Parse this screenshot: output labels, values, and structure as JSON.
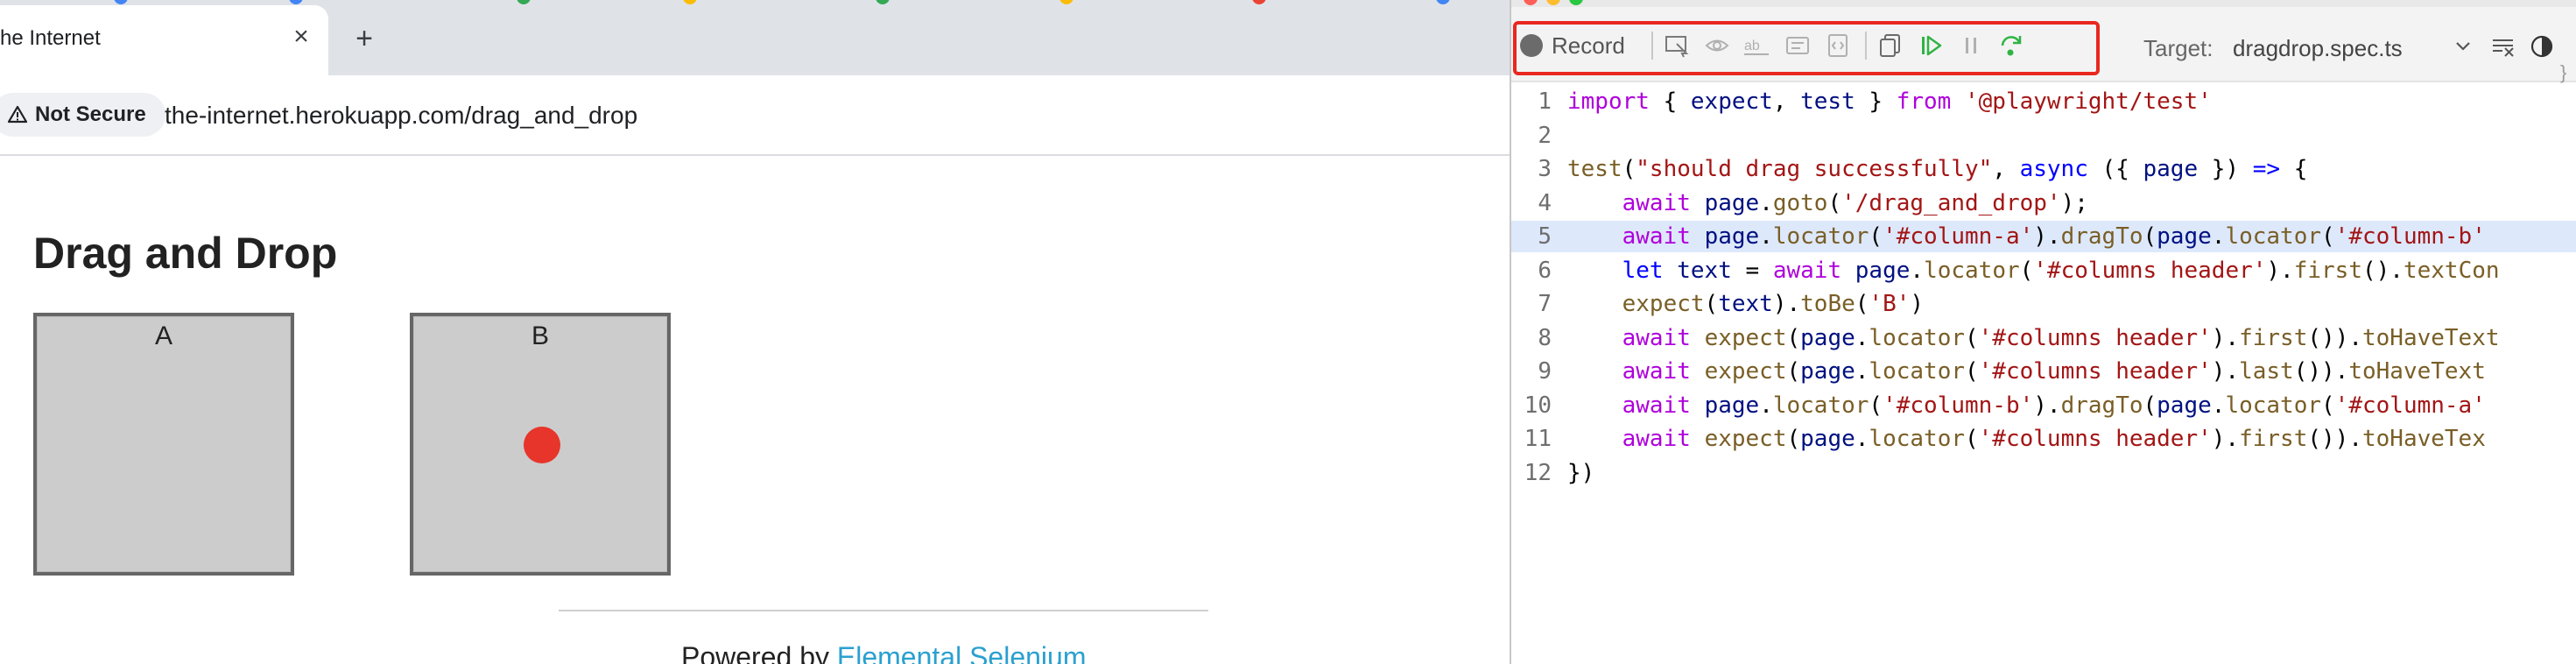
{
  "browser": {
    "tab": {
      "title": "he Internet",
      "close_glyph": "×"
    },
    "new_tab_glyph": "+",
    "security_label": "Not Secure",
    "url": "the-internet.herokuapp.com/drag_and_drop"
  },
  "page": {
    "heading": "Drag and Drop",
    "columns": [
      {
        "header": "A"
      },
      {
        "header": "B"
      }
    ],
    "footer": {
      "prefix": "Powered by ",
      "link": "Elemental Selenium"
    }
  },
  "inspector": {
    "toolbar": {
      "record_label": "Record",
      "target_label": "Target:",
      "target_value": "dragdrop.spec.ts"
    },
    "code_lines": [
      {
        "n": "1",
        "active": false,
        "tokens": [
          [
            "kw2",
            "import"
          ],
          [
            "plain",
            " { "
          ],
          [
            "var",
            "expect"
          ],
          [
            "plain",
            ", "
          ],
          [
            "var",
            "test"
          ],
          [
            "plain",
            " } "
          ],
          [
            "kw2",
            "from"
          ],
          [
            "plain",
            " "
          ],
          [
            "str",
            "'@playwright/test'"
          ]
        ]
      },
      {
        "n": "2",
        "active": false,
        "tokens": []
      },
      {
        "n": "3",
        "active": false,
        "tokens": [
          [
            "fn",
            "test"
          ],
          [
            "plain",
            "("
          ],
          [
            "str",
            "\"should drag successfully\""
          ],
          [
            "plain",
            ", "
          ],
          [
            "kw",
            "async"
          ],
          [
            "plain",
            " ({ "
          ],
          [
            "var",
            "page"
          ],
          [
            "plain",
            " }) "
          ],
          [
            "kw",
            "=>"
          ],
          [
            "plain",
            " {"
          ]
        ]
      },
      {
        "n": "4",
        "active": false,
        "tokens": [
          [
            "plain",
            "    "
          ],
          [
            "kw2",
            "await"
          ],
          [
            "plain",
            " "
          ],
          [
            "var",
            "page"
          ],
          [
            "plain",
            "."
          ],
          [
            "fn",
            "goto"
          ],
          [
            "plain",
            "("
          ],
          [
            "str",
            "'/drag_and_drop'"
          ],
          [
            "plain",
            ");"
          ]
        ]
      },
      {
        "n": "5",
        "active": true,
        "tokens": [
          [
            "plain",
            "    "
          ],
          [
            "kw2",
            "await"
          ],
          [
            "plain",
            " "
          ],
          [
            "var",
            "page"
          ],
          [
            "plain",
            "."
          ],
          [
            "fn",
            "locator"
          ],
          [
            "plain",
            "("
          ],
          [
            "str",
            "'#column-a'"
          ],
          [
            "plain",
            ")."
          ],
          [
            "fn",
            "dragTo"
          ],
          [
            "plain",
            "("
          ],
          [
            "var",
            "page"
          ],
          [
            "plain",
            "."
          ],
          [
            "fn",
            "locator"
          ],
          [
            "plain",
            "("
          ],
          [
            "str",
            "'#column-b'"
          ]
        ]
      },
      {
        "n": "6",
        "active": false,
        "tokens": [
          [
            "plain",
            "    "
          ],
          [
            "kw",
            "let"
          ],
          [
            "plain",
            " "
          ],
          [
            "var",
            "text"
          ],
          [
            "plain",
            " = "
          ],
          [
            "kw2",
            "await"
          ],
          [
            "plain",
            " "
          ],
          [
            "var",
            "page"
          ],
          [
            "plain",
            "."
          ],
          [
            "fn",
            "locator"
          ],
          [
            "plain",
            "("
          ],
          [
            "str",
            "'#columns header'"
          ],
          [
            "plain",
            ")."
          ],
          [
            "fn",
            "first"
          ],
          [
            "plain",
            "()."
          ],
          [
            "fn",
            "textCon"
          ]
        ]
      },
      {
        "n": "7",
        "active": false,
        "tokens": [
          [
            "plain",
            "    "
          ],
          [
            "fn",
            "expect"
          ],
          [
            "plain",
            "("
          ],
          [
            "var",
            "text"
          ],
          [
            "plain",
            ")."
          ],
          [
            "fn",
            "toBe"
          ],
          [
            "plain",
            "("
          ],
          [
            "str",
            "'B'"
          ],
          [
            "plain",
            ")"
          ]
        ]
      },
      {
        "n": "8",
        "active": false,
        "tokens": [
          [
            "plain",
            "    "
          ],
          [
            "kw2",
            "await"
          ],
          [
            "plain",
            " "
          ],
          [
            "fn",
            "expect"
          ],
          [
            "plain",
            "("
          ],
          [
            "var",
            "page"
          ],
          [
            "plain",
            "."
          ],
          [
            "fn",
            "locator"
          ],
          [
            "plain",
            "("
          ],
          [
            "str",
            "'#columns header'"
          ],
          [
            "plain",
            ")."
          ],
          [
            "fn",
            "first"
          ],
          [
            "plain",
            "())."
          ],
          [
            "fn",
            "toHaveText"
          ]
        ]
      },
      {
        "n": "9",
        "active": false,
        "tokens": [
          [
            "plain",
            "    "
          ],
          [
            "kw2",
            "await"
          ],
          [
            "plain",
            " "
          ],
          [
            "fn",
            "expect"
          ],
          [
            "plain",
            "("
          ],
          [
            "var",
            "page"
          ],
          [
            "plain",
            "."
          ],
          [
            "fn",
            "locator"
          ],
          [
            "plain",
            "("
          ],
          [
            "str",
            "'#columns header'"
          ],
          [
            "plain",
            ")."
          ],
          [
            "fn",
            "last"
          ],
          [
            "plain",
            "())."
          ],
          [
            "fn",
            "toHaveText"
          ]
        ]
      },
      {
        "n": "10",
        "active": false,
        "tokens": [
          [
            "plain",
            "    "
          ],
          [
            "kw2",
            "await"
          ],
          [
            "plain",
            " "
          ],
          [
            "var",
            "page"
          ],
          [
            "plain",
            "."
          ],
          [
            "fn",
            "locator"
          ],
          [
            "plain",
            "("
          ],
          [
            "str",
            "'#column-b'"
          ],
          [
            "plain",
            ")."
          ],
          [
            "fn",
            "dragTo"
          ],
          [
            "plain",
            "("
          ],
          [
            "var",
            "page"
          ],
          [
            "plain",
            "."
          ],
          [
            "fn",
            "locator"
          ],
          [
            "plain",
            "("
          ],
          [
            "str",
            "'#column-a'"
          ]
        ]
      },
      {
        "n": "11",
        "active": false,
        "tokens": [
          [
            "plain",
            "    "
          ],
          [
            "kw2",
            "await"
          ],
          [
            "plain",
            " "
          ],
          [
            "fn",
            "expect"
          ],
          [
            "plain",
            "("
          ],
          [
            "var",
            "page"
          ],
          [
            "plain",
            "."
          ],
          [
            "fn",
            "locator"
          ],
          [
            "plain",
            "("
          ],
          [
            "str",
            "'#columns header'"
          ],
          [
            "plain",
            ")."
          ],
          [
            "fn",
            "first"
          ],
          [
            "plain",
            "())."
          ],
          [
            "fn",
            "toHaveTex"
          ]
        ]
      },
      {
        "n": "12",
        "active": false,
        "tokens": [
          [
            "plain",
            "})"
          ]
        ]
      }
    ]
  },
  "colors": {
    "record_highlight": "#e8281f",
    "drag_dot": "#e7352b",
    "column_fill": "#cccccc",
    "active_line": "#dde8fb",
    "link": "#2aa0d0"
  },
  "icons": [
    "warning-icon",
    "pick-locator-icon",
    "assert-visibility-icon",
    "assert-text-icon",
    "assert-value-icon",
    "assert-snapshot-icon",
    "copy-icon",
    "resume-icon",
    "pause-icon",
    "step-over-icon",
    "chevron-down-icon",
    "clear-icon",
    "theme-toggle-icon"
  ]
}
